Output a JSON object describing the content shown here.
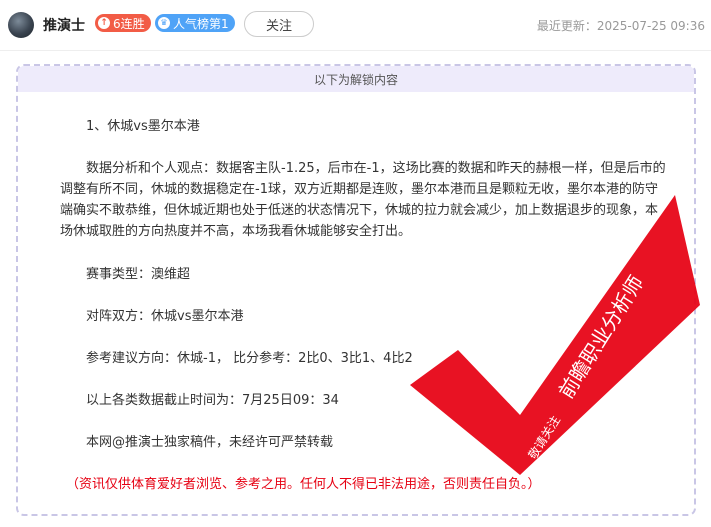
{
  "header": {
    "author": "推演士",
    "streak_badge": "6连胜",
    "popularity_badge": "人气榜第1",
    "follow_label": "关注",
    "last_update": "最近更新：2025-07-25 09:36"
  },
  "card": {
    "header": "以下为解锁内容",
    "title": "1、休城vs墨尔本港",
    "analysis": "数据分析和个人观点：数据客主队-1.25，后市在-1，这场比赛的数据和昨天的赫根一样，但是后市的调整有所不同，休城的数据稳定在-1球，双方近期都是连败，墨尔本港而且是颗粒无收，墨尔本港的防守端确实不敢恭维，但休城近期也处于低迷的状态情况下，休城的拉力就会减少，加上数据退步的现象，本场休城取胜的方向热度并不高，本场我看休城能够安全打出。",
    "match_type": "赛事类型：澳维超",
    "teams": "对阵双方：休城vs墨尔本港",
    "suggestion": "参考建议方向：休城-1，  比分参考：2比0、3比1、4比2",
    "deadline": "以上各类数据截止时间为：7月25日09：34",
    "copyright": "本网@推演士独家稿件，未经许可严禁转载",
    "disclaimer": "（资讯仅供体育爱好者浏览、参考之用。任何人不得已非法用途，否则责任自负。）"
  },
  "stamp": {
    "title": "前瞻职业分析师",
    "subtitle": "敬请关注",
    "color": "#e60012"
  }
}
